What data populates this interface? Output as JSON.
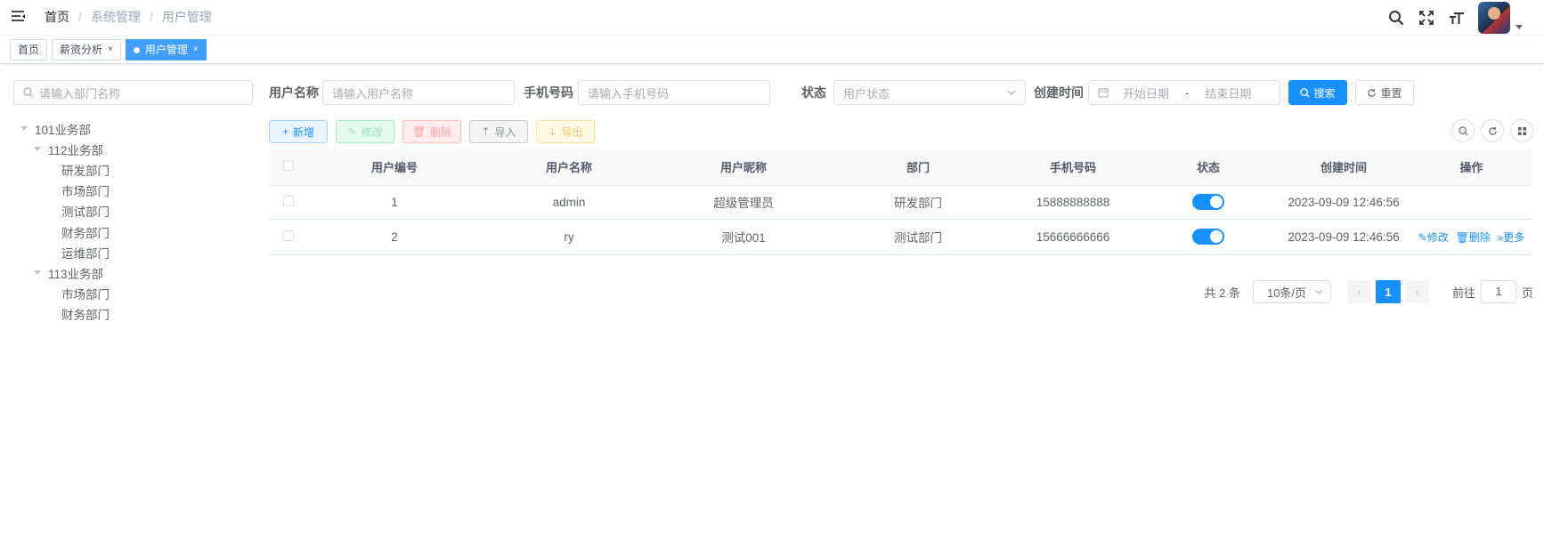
{
  "breadcrumb": {
    "home": "首页",
    "section": "系统管理",
    "current": "用户管理",
    "sep": "/"
  },
  "tags": [
    {
      "label": "首页",
      "active": false
    },
    {
      "label": "薪资分析",
      "active": false,
      "close": "×"
    },
    {
      "label": "用户管理",
      "active": true,
      "close": "×"
    }
  ],
  "left": {
    "search_placeholder": "请输入部门名称",
    "tree": [
      {
        "label": "101业务部",
        "level": 0,
        "expandable": true
      },
      {
        "label": "112业务部",
        "level": 1,
        "expandable": true
      },
      {
        "label": "研发部门",
        "level": 2
      },
      {
        "label": "市场部门",
        "level": 2
      },
      {
        "label": "测试部门",
        "level": 2
      },
      {
        "label": "财务部门",
        "level": 2
      },
      {
        "label": "运维部门",
        "level": 2
      },
      {
        "label": "113业务部",
        "level": 1,
        "expandable": true
      },
      {
        "label": "市场部门",
        "level": 2
      },
      {
        "label": "财务部门",
        "level": 2
      }
    ]
  },
  "search_form": {
    "username_label": "用户名称",
    "username_placeholder": "请输入用户名称",
    "phone_label": "手机号码",
    "phone_placeholder": "请输入手机号码",
    "status_label": "状态",
    "status_placeholder": "用户状态",
    "created_label": "创建时间",
    "start_placeholder": "开始日期",
    "range_sep": "-",
    "end_placeholder": "结束日期",
    "search_btn": "搜索",
    "reset_btn": "重置"
  },
  "toolbar": {
    "add": "新增",
    "edit": "修改",
    "delete": "删除",
    "import": "导入",
    "export": "导出"
  },
  "table": {
    "headers": [
      "用户编号",
      "用户名称",
      "用户昵称",
      "部门",
      "手机号码",
      "状态",
      "创建时间",
      "操作"
    ],
    "rows": [
      {
        "id": "1",
        "username": "admin",
        "nickname": "超级管理员",
        "dept": "研发部门",
        "phone": "15888888888",
        "status": true,
        "created": "2023-09-09 12:46:56",
        "ops": []
      },
      {
        "id": "2",
        "username": "ry",
        "nickname": "测试001",
        "dept": "测试部门",
        "phone": "15666666666",
        "status": true,
        "created": "2023-09-09 12:46:56",
        "ops": [
          "修改",
          "删除",
          "更多"
        ]
      }
    ]
  },
  "pagination": {
    "total": "共 2 条",
    "page_size": "10条/页",
    "current_page": "1",
    "goto_label": "前往",
    "goto_value": "1",
    "page_unit": "页"
  },
  "colors": {
    "primary": "#1890ff",
    "tag_active": "#409eff"
  }
}
